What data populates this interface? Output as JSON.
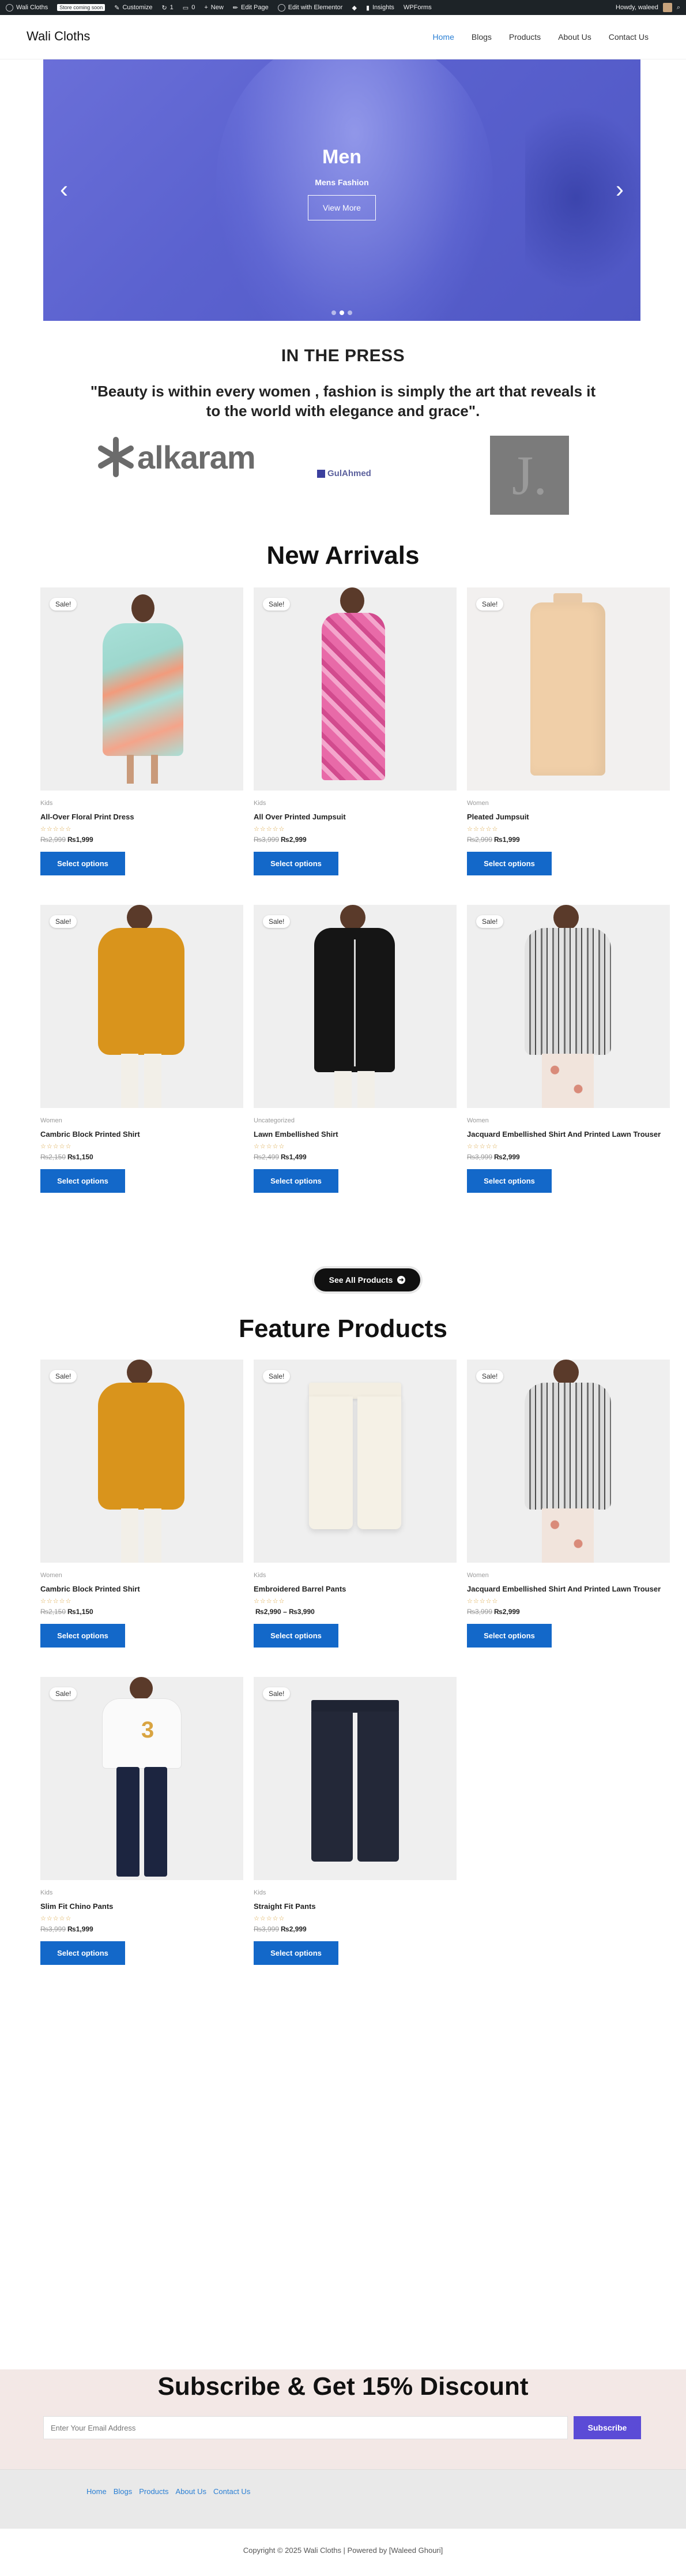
{
  "admin_bar": {
    "items": [
      {
        "label": "Wali Cloths",
        "icon": "wordpress-icon"
      },
      {
        "label": "Customize",
        "icon": "paintbrush-icon"
      },
      {
        "label": "1",
        "icon": "updates-icon"
      },
      {
        "label": "0",
        "icon": "comments-icon"
      },
      {
        "label": "New",
        "icon": "plus-icon"
      },
      {
        "label": "Edit Page",
        "icon": "pencil-icon"
      },
      {
        "label": "Edit with Elementor",
        "icon": "elementor-icon"
      },
      {
        "label": "",
        "icon": "diamond-icon"
      },
      {
        "label": "Insights",
        "icon": "chart-icon"
      },
      {
        "label": "WPForms",
        "icon": "forms-icon"
      }
    ],
    "badge": "Store coming soon",
    "howdy": "Howdy, waleed"
  },
  "header": {
    "logo": "Wali Cloths",
    "nav": [
      "Home",
      "Blogs",
      "Products",
      "About Us",
      "Contact Us"
    ],
    "active_index": 0
  },
  "hero": {
    "title": "Men",
    "subtitle": "Mens Fashion",
    "button": "View More",
    "prev_icon": "‹",
    "next_icon": "›",
    "slides": 3,
    "active_slide": 1
  },
  "press": {
    "title": "IN THE PRESS",
    "quote": "\"Beauty is within every women , fashion is simply the art that reveals it to the world with elegance and grace\".",
    "brands": [
      "alkaram",
      "GulAhmed",
      "J."
    ]
  },
  "new_arrivals": {
    "title": "New Arrivals",
    "products": [
      {
        "category": "Kids",
        "name": "All-Over Floral Print Dress",
        "old": "₨2,999",
        "price": "₨1,999",
        "badge": "Sale!",
        "button": "Select options"
      },
      {
        "category": "Kids",
        "name": "All Over Printed Jumpsuit",
        "old": "₨3,999",
        "price": "₨2,999",
        "badge": "Sale!",
        "button": "Select options"
      },
      {
        "category": "Women",
        "name": "Pleated Jumpsuit",
        "old": "₨2,999",
        "price": "₨1,999",
        "badge": "Sale!",
        "button": "Select options"
      },
      {
        "category": "Women",
        "name": "Cambric Block Printed Shirt",
        "old": "₨2,150",
        "price": "₨1,150",
        "badge": "Sale!",
        "button": "Select options"
      },
      {
        "category": "Uncategorized",
        "name": "Lawn Embellished Shirt",
        "old": "₨2,499",
        "price": "₨1,499",
        "badge": "Sale!",
        "button": "Select options"
      },
      {
        "category": "Women",
        "name": "Jacquard Embellished Shirt And Printed Lawn Trouser",
        "old": "₨3,999",
        "price": "₨2,999",
        "badge": "Sale!",
        "button": "Select options"
      }
    ],
    "see_all": "See All Products"
  },
  "feature_products": {
    "title": "Feature Products",
    "products": [
      {
        "category": "Women",
        "name": "Cambric Block Printed Shirt",
        "old": "₨2,150",
        "price": "₨1,150",
        "badge": "Sale!",
        "button": "Select options"
      },
      {
        "category": "Kids",
        "name": "Embroidered Barrel Pants",
        "old": "",
        "price": "₨2,990 – ₨3,990",
        "badge": "Sale!",
        "button": "Select options"
      },
      {
        "category": "Women",
        "name": "Jacquard Embellished Shirt And Printed Lawn Trouser",
        "old": "₨3,999",
        "price": "₨2,999",
        "badge": "Sale!",
        "button": "Select options"
      },
      {
        "category": "Kids",
        "name": "Slim Fit Chino Pants",
        "old": "₨3,999",
        "price": "₨1,999",
        "badge": "Sale!",
        "button": "Select options"
      },
      {
        "category": "Kids",
        "name": "Straight Fit Pants",
        "old": "₨3,999",
        "price": "₨2,999",
        "badge": "Sale!",
        "button": "Select options"
      }
    ]
  },
  "subscribe": {
    "title": "Subscribe & Get 15% Discount",
    "placeholder": "Enter Your Email Address",
    "button": "Subscribe"
  },
  "footer": {
    "links": [
      "Home",
      "Blogs",
      "Products",
      "About Us",
      "Contact Us"
    ],
    "copyright": "Copyright © 2025 Wali Cloths | Powered by [Waleed Ghouri]"
  },
  "stars": "☆☆☆☆☆",
  "colors": {
    "accent": "#1368c9",
    "hero": "#5b62cf",
    "subscribe_bg": "#f3e8e6",
    "subscribe_btn": "#5b4bd6"
  }
}
